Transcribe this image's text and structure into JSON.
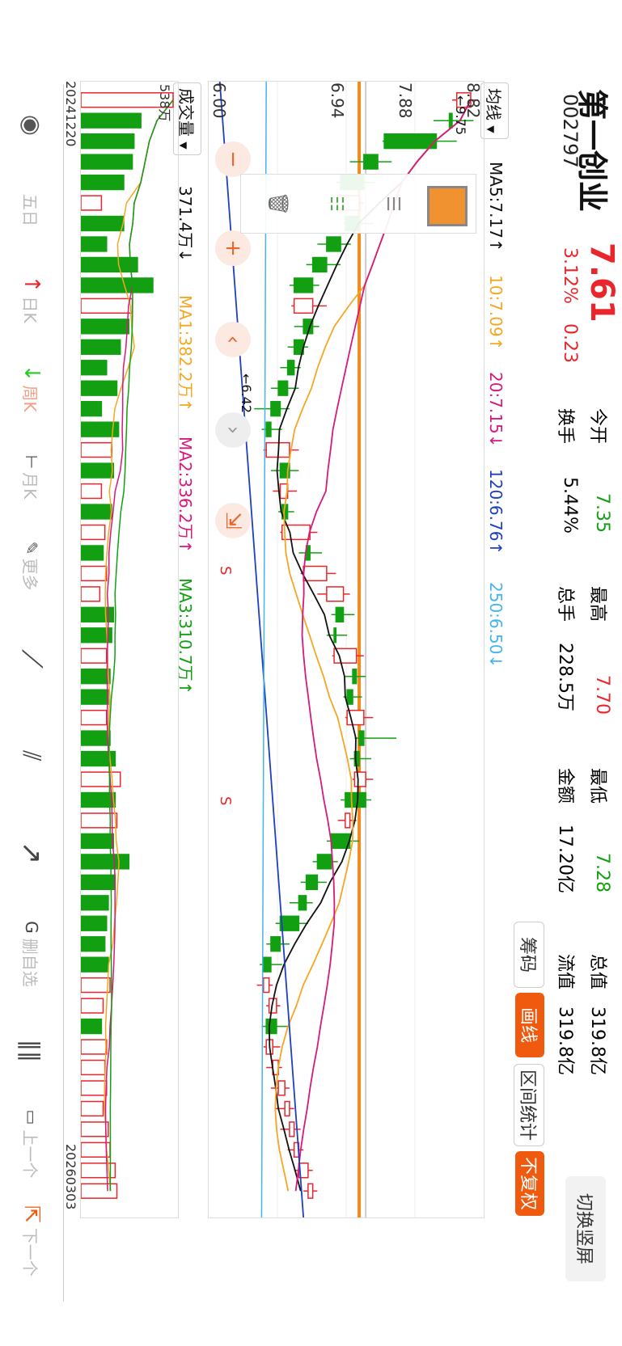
{
  "stock": {
    "name": "第一创业",
    "code": "002797",
    "price": "7.61",
    "change_pct": "3.12%",
    "change_amt": "0.23"
  },
  "stats": {
    "open_label": "今开",
    "open_value": "7.35",
    "turnover_label": "换手",
    "turnover_value": "5.44%",
    "high_label": "最高",
    "high_value": "7.70",
    "volume_label": "总手",
    "volume_value": "228.5万",
    "low_label": "最低",
    "low_value": "7.28",
    "amount_label": "金额",
    "amount_value": "17.20亿",
    "mktcap_label": "总值",
    "mktcap_value": "319.8亿",
    "float_label": "流值",
    "float_value": "319.8亿"
  },
  "buttons": {
    "switch_label": "切换竖屏",
    "chips_label": "筹码",
    "draw_label": "画线",
    "range_label": "区间统计",
    "adjust_label": "不复权"
  },
  "ma_bar": {
    "selector_label": "均线",
    "ma5": "MA5:7.17↑",
    "ma10": "10:7.09↑",
    "ma20": "20:7.15↓",
    "ma120": "120:6.76↑",
    "ma250": "250:6.50↓"
  },
  "vol_bar": {
    "selector_label": "成交量",
    "current": "371.4万↓",
    "ma1": "MA1:382.2万↑",
    "ma2": "MA2:336.2万↑",
    "ma3": "MA3:310.7万↑"
  },
  "price_axis": {
    "top": "8.82",
    "mid1": "7.88",
    "mid2": "6.94",
    "bottom": "6.00"
  },
  "vol_axis": {
    "top": "538万"
  },
  "annotations": {
    "high_marker": "9.75",
    "low_marker": "6.42",
    "signal1": "S",
    "signal2": "S"
  },
  "dates": {
    "start": "20241220",
    "end": "20260303"
  },
  "tools": [
    {
      "label": "五日"
    },
    {
      "label": "日K"
    },
    {
      "label": "周K"
    },
    {
      "label": "月K"
    },
    {
      "label": "更多"
    },
    {
      "label": ""
    },
    {
      "label": ""
    },
    {
      "label": ""
    },
    {
      "label": "删自选"
    },
    {
      "label": ""
    },
    {
      "label": "上一个"
    },
    {
      "label": "下一个"
    }
  ],
  "colors": {
    "up": "#e8262b",
    "down": "#12a012",
    "accent": "#ef5a0f",
    "ma5": "#111111",
    "ma10": "#f5a623",
    "ma20": "#d6197c",
    "ma120": "#1e3fbf",
    "ma250": "#45b4ef"
  },
  "chart_data": {
    "type": "candlestick",
    "ylim": [
      6.0,
      8.82
    ],
    "candles": [
      [
        8.6,
        8.82,
        8.75,
        8.55
      ],
      [
        8.55,
        8.78,
        8.52,
        8.35
      ],
      [
        8.38,
        8.6,
        7.82,
        7.8
      ],
      [
        7.75,
        7.9,
        7.6,
        7.45
      ],
      [
        7.6,
        7.72,
        7.35,
        7.3
      ],
      [
        7.32,
        7.6,
        7.55,
        7.2
      ],
      [
        7.55,
        7.7,
        7.4,
        7.38
      ],
      [
        7.35,
        7.46,
        7.2,
        7.1
      ],
      [
        7.2,
        7.35,
        7.05,
        6.98
      ],
      [
        7.05,
        7.12,
        6.85,
        6.8
      ],
      [
        6.85,
        7.2,
        7.05,
        6.82
      ],
      [
        7.05,
        7.12,
        6.95,
        6.85
      ],
      [
        6.95,
        7.0,
        6.85,
        6.78
      ],
      [
        6.85,
        6.92,
        6.78,
        6.7
      ],
      [
        6.78,
        6.9,
        6.68,
        6.6
      ],
      [
        6.7,
        6.8,
        6.6,
        6.42
      ],
      [
        6.6,
        6.72,
        6.55,
        6.5
      ],
      [
        6.55,
        6.9,
        6.8,
        6.52
      ],
      [
        6.8,
        6.9,
        6.7,
        6.6
      ],
      [
        6.7,
        6.88,
        6.78,
        6.62
      ],
      [
        6.78,
        6.85,
        6.72,
        6.68
      ],
      [
        6.72,
        7.1,
        7.02,
        6.7
      ],
      [
        7.02,
        7.15,
        6.98,
        6.9
      ],
      [
        6.95,
        7.3,
        7.2,
        6.92
      ],
      [
        7.2,
        7.45,
        7.38,
        7.1
      ],
      [
        7.38,
        7.5,
        7.3,
        7.25
      ],
      [
        7.3,
        7.42,
        7.28,
        7.2
      ],
      [
        7.28,
        7.6,
        7.52,
        7.26
      ],
      [
        7.52,
        7.62,
        7.48,
        7.4
      ],
      [
        7.48,
        7.58,
        7.42,
        7.38
      ],
      [
        7.42,
        7.7,
        7.6,
        7.4
      ],
      [
        7.6,
        7.95,
        7.55,
        7.5
      ],
      [
        7.55,
        7.68,
        7.5,
        7.45
      ],
      [
        7.5,
        7.7,
        7.62,
        7.48
      ],
      [
        7.62,
        7.68,
        7.4,
        7.35
      ],
      [
        7.4,
        7.52,
        7.45,
        7.32
      ],
      [
        7.45,
        7.55,
        7.25,
        7.2
      ],
      [
        7.25,
        7.32,
        7.1,
        7.05
      ],
      [
        7.1,
        7.2,
        6.98,
        6.92
      ],
      [
        6.98,
        7.05,
        6.9,
        6.8
      ],
      [
        6.9,
        7.0,
        6.7,
        6.65
      ],
      [
        6.7,
        6.8,
        6.6,
        6.55
      ],
      [
        6.6,
        6.72,
        6.52,
        6.48
      ],
      [
        6.52,
        6.62,
        6.58,
        6.45
      ],
      [
        6.58,
        6.7,
        6.66,
        6.55
      ],
      [
        6.66,
        6.78,
        6.55,
        6.5
      ],
      [
        6.55,
        6.7,
        6.62,
        6.52
      ],
      [
        6.62,
        6.72,
        6.68,
        6.55
      ],
      [
        6.68,
        6.8,
        6.75,
        6.6
      ],
      [
        6.75,
        6.85,
        6.8,
        6.65
      ],
      [
        6.8,
        6.92,
        6.85,
        6.7
      ],
      [
        6.85,
        6.95,
        6.9,
        6.78
      ],
      [
        6.9,
        7.05,
        7.0,
        6.85
      ],
      [
        7.0,
        7.1,
        7.05,
        6.95
      ]
    ],
    "volumes": [
      538,
      350,
      310,
      300,
      250,
      120,
      250,
      150,
      330,
      420,
      300,
      280,
      230,
      150,
      210,
      120,
      220,
      180,
      190,
      120,
      180,
      140,
      130,
      150,
      110,
      190,
      180,
      150,
      170,
      160,
      150,
      170,
      200,
      230,
      200,
      210,
      190,
      280,
      200,
      160,
      150,
      140,
      160,
      170,
      130,
      120,
      150,
      140,
      150,
      130,
      160,
      170,
      200,
      210
    ]
  }
}
